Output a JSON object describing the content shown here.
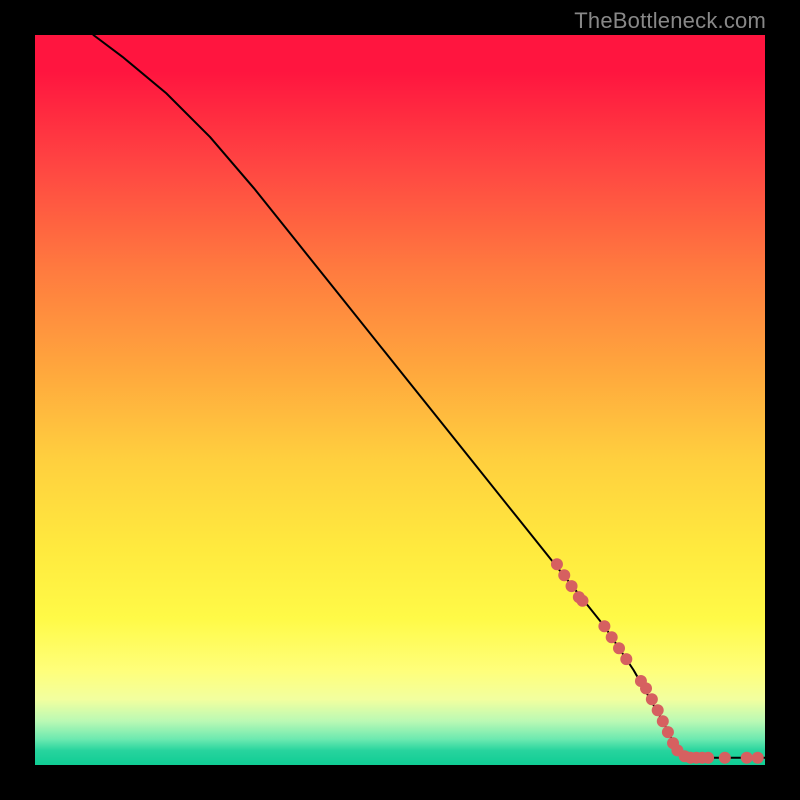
{
  "watermark": "TheBottleneck.com",
  "chart_data": {
    "type": "line",
    "title": "",
    "xlabel": "",
    "ylabel": "",
    "xlim": [
      0,
      100
    ],
    "ylim": [
      0,
      100
    ],
    "curve": [
      {
        "x": 8,
        "y": 100
      },
      {
        "x": 12,
        "y": 97
      },
      {
        "x": 18,
        "y": 92
      },
      {
        "x": 24,
        "y": 86
      },
      {
        "x": 30,
        "y": 79
      },
      {
        "x": 36,
        "y": 71.5
      },
      {
        "x": 42,
        "y": 64
      },
      {
        "x": 48,
        "y": 56.5
      },
      {
        "x": 54,
        "y": 49
      },
      {
        "x": 60,
        "y": 41.5
      },
      {
        "x": 66,
        "y": 34
      },
      {
        "x": 72,
        "y": 26.5
      },
      {
        "x": 78,
        "y": 19
      },
      {
        "x": 82,
        "y": 13
      },
      {
        "x": 86,
        "y": 6
      },
      {
        "x": 88,
        "y": 2
      },
      {
        "x": 89,
        "y": 1
      },
      {
        "x": 90,
        "y": 1
      },
      {
        "x": 94,
        "y": 1
      },
      {
        "x": 100,
        "y": 1
      }
    ],
    "points": [
      {
        "x": 71.5,
        "y": 27.5
      },
      {
        "x": 72.5,
        "y": 26.0
      },
      {
        "x": 73.5,
        "y": 24.5
      },
      {
        "x": 74.5,
        "y": 23.0
      },
      {
        "x": 75.0,
        "y": 22.5
      },
      {
        "x": 78.0,
        "y": 19.0
      },
      {
        "x": 79.0,
        "y": 17.5
      },
      {
        "x": 80.0,
        "y": 16.0
      },
      {
        "x": 81.0,
        "y": 14.5
      },
      {
        "x": 83.0,
        "y": 11.5
      },
      {
        "x": 83.7,
        "y": 10.5
      },
      {
        "x": 84.5,
        "y": 9.0
      },
      {
        "x": 85.3,
        "y": 7.5
      },
      {
        "x": 86.0,
        "y": 6.0
      },
      {
        "x": 86.7,
        "y": 4.5
      },
      {
        "x": 87.4,
        "y": 3.0
      },
      {
        "x": 88.0,
        "y": 2.0
      },
      {
        "x": 89.0,
        "y": 1.2
      },
      {
        "x": 89.8,
        "y": 1.0
      },
      {
        "x": 90.6,
        "y": 1.0
      },
      {
        "x": 91.4,
        "y": 1.0
      },
      {
        "x": 92.2,
        "y": 1.0
      },
      {
        "x": 94.5,
        "y": 1.0
      },
      {
        "x": 97.5,
        "y": 1.0
      },
      {
        "x": 99.0,
        "y": 1.0
      }
    ],
    "point_color": "#d66060",
    "curve_color": "#000000"
  }
}
